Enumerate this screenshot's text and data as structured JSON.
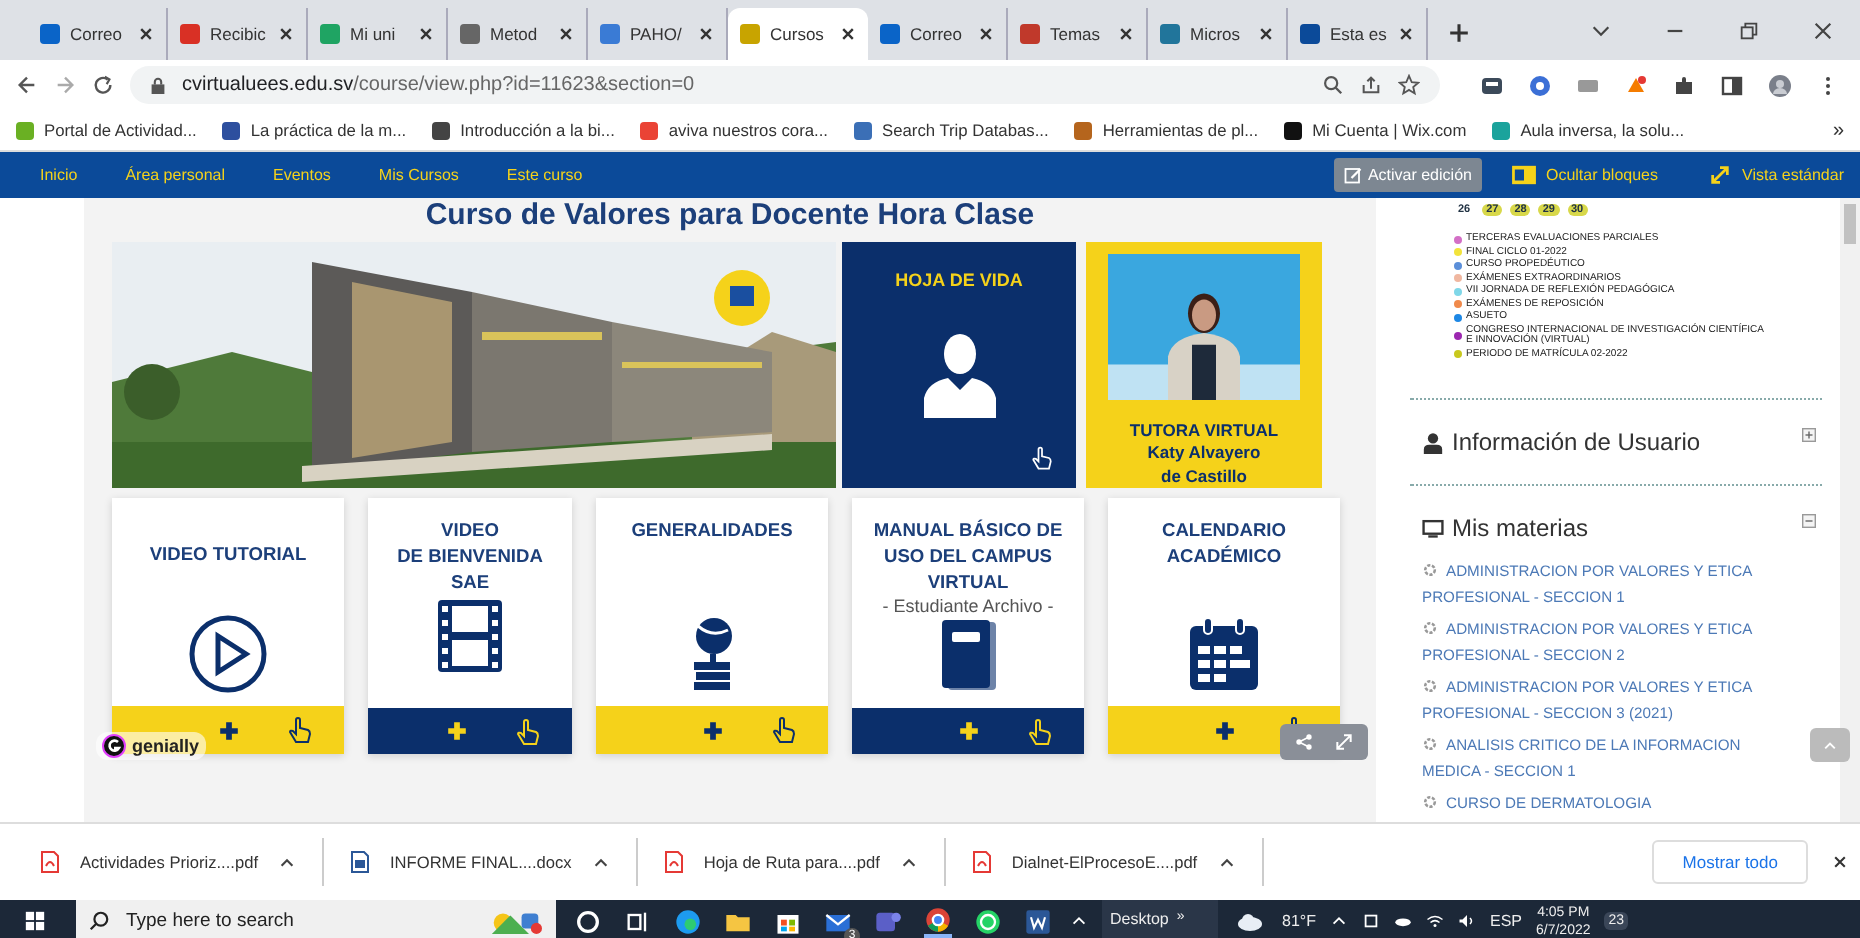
{
  "browser": {
    "tabs": [
      {
        "title": "Correo",
        "selected": false,
        "color": "#0a64c8"
      },
      {
        "title": "Recibic",
        "selected": false,
        "color": "#d93025"
      },
      {
        "title": "Mi uni",
        "selected": false,
        "color": "#1fa463"
      },
      {
        "title": "Metod",
        "selected": false,
        "color": "#666666"
      },
      {
        "title": "PAHO/",
        "selected": false,
        "color": "#3a7bd5"
      },
      {
        "title": "Cursos",
        "selected": true,
        "color": "#c8a400"
      },
      {
        "title": "Correo",
        "selected": false,
        "color": "#0a64c8"
      },
      {
        "title": "Temas",
        "selected": false,
        "color": "#c0392b"
      },
      {
        "title": "Micros",
        "selected": false,
        "color": "#21759b"
      },
      {
        "title": "Esta es",
        "selected": false,
        "color": "#0b4a99"
      }
    ],
    "url_host": "cvirtualuees.edu.sv",
    "url_path": "/course/view.php?id=11623&section=0",
    "bookmarks": [
      {
        "label": "Portal de Actividad...",
        "color": "#6ab023"
      },
      {
        "label": "La práctica de la m...",
        "color": "#2d4f9e"
      },
      {
        "label": "Introducción a la bi...",
        "color": "#444444"
      },
      {
        "label": "aviva nuestros cora...",
        "color": "#ea4335"
      },
      {
        "label": "Search Trip Databas...",
        "color": "#3b6fb6"
      },
      {
        "label": "Herramientas de pl...",
        "color": "#b5651d"
      },
      {
        "label": "Mi Cuenta | Wix.com",
        "color": "#111111"
      },
      {
        "label": "Aula inversa, la solu...",
        "color": "#1ba39c"
      }
    ],
    "bookmarks_more": "»"
  },
  "nav": {
    "items": [
      "Inicio",
      "Área personal",
      "Eventos",
      "Mis Cursos",
      "Este curso"
    ],
    "edit_button": "Activar edición",
    "hide_blocks": "Ocultar bloques",
    "standard_view": "Vista estándar"
  },
  "course": {
    "title": "Curso de Valores para Docente Hora Clase",
    "resume_card": {
      "title": "HOJA DE VIDA"
    },
    "tutor_card": {
      "role": "TUTORA VIRTUAL",
      "name_lines": [
        "Katy Alvayero",
        "de Castillo"
      ]
    },
    "cards": [
      {
        "title_lines": [
          "VIDEO TUTORIAL"
        ],
        "kind": "play",
        "color": "#f5d21a"
      },
      {
        "title_lines": [
          "VIDEO",
          "DE BIENVENIDA",
          "SAE"
        ],
        "kind": "film",
        "color": "#0b2f6b"
      },
      {
        "title_lines": [
          "GENERALIDADES"
        ],
        "kind": "globe",
        "color": "#f5d21a"
      },
      {
        "title_lines": [
          "MANUAL BÁSICO DE",
          "USO DEL CAMPUS",
          "VIRTUAL"
        ],
        "subtitle": "- Estudiante Archivo -",
        "kind": "book",
        "color": "#0b2f6b"
      },
      {
        "title_lines": [
          "CALENDARIO",
          "ACADÉMICO"
        ],
        "kind": "calendar",
        "color": "#f5d21a"
      }
    ],
    "brand": "genially"
  },
  "calendar": {
    "days": [
      {
        "day": "26",
        "highlighted": false
      },
      {
        "day": "27",
        "highlighted": true
      },
      {
        "day": "28",
        "highlighted": true
      },
      {
        "day": "29",
        "highlighted": true
      },
      {
        "day": "30",
        "highlighted": true
      }
    ],
    "legend": [
      {
        "label": "TERCERAS EVALUACIONES PARCIALES",
        "color": "#d36fc6"
      },
      {
        "label": "FINAL CICLO 01-2022",
        "color": "#f2e33b"
      },
      {
        "label": "CURSO PROPEDÉUTICO",
        "color": "#5b8fd9"
      },
      {
        "label": "EXÁMENES EXTRAORDINARIOS",
        "color": "#f0b7a0"
      },
      {
        "label": "VII JORNADA DE REFLEXIÓN PEDAGÓGICA",
        "color": "#7fd7e8"
      },
      {
        "label": "EXÁMENES DE REPOSICIÓN",
        "color": "#f08a4b"
      },
      {
        "label": "ASUETO",
        "color": "#1e88e5"
      },
      {
        "label": "CONGRESO INTERNACIONAL DE INVESTIGACIÓN CIENTÍFICA E INNOVACIÓN (VIRTUAL)",
        "color": "#9c27b0"
      },
      {
        "label": "PERIODO DE MATRÍCULA 02-2022",
        "color": "#c8c81e"
      }
    ]
  },
  "blocks": {
    "user_info": {
      "title": "Información de Usuario",
      "expanded": false
    },
    "courses": {
      "title": "Mis materias",
      "expanded": true,
      "items": [
        "ADMINISTRACION POR VALORES Y ETICA PROFESIONAL - SECCION 1",
        "ADMINISTRACION POR VALORES Y ETICA PROFESIONAL - SECCION 2",
        "ADMINISTRACION POR VALORES Y ETICA PROFESIONAL - SECCION 3 (2021)",
        "ANALISIS CRITICO DE LA INFORMACION MEDICA - SECCION 1",
        "CURSO DE DERMATOLOGIA"
      ]
    }
  },
  "downloads": {
    "items": [
      {
        "name": "Actividades Prioriz....pdf",
        "kind": "pdf"
      },
      {
        "name": "INFORME FINAL....docx",
        "kind": "docx"
      },
      {
        "name": "Hoja de Ruta para....pdf",
        "kind": "pdf"
      },
      {
        "name": "Dialnet-ElProcesoE....pdf",
        "kind": "pdf"
      }
    ],
    "show_all": "Mostrar todo"
  },
  "taskbar": {
    "search_placeholder": "Type here to search",
    "mail_badge": "3",
    "toolbar": "Desktop",
    "toolbar_more": "»",
    "temperature": "81°F",
    "language": "ESP",
    "time": "4:05 PM",
    "date": "6/7/2022",
    "notifications": "23"
  }
}
